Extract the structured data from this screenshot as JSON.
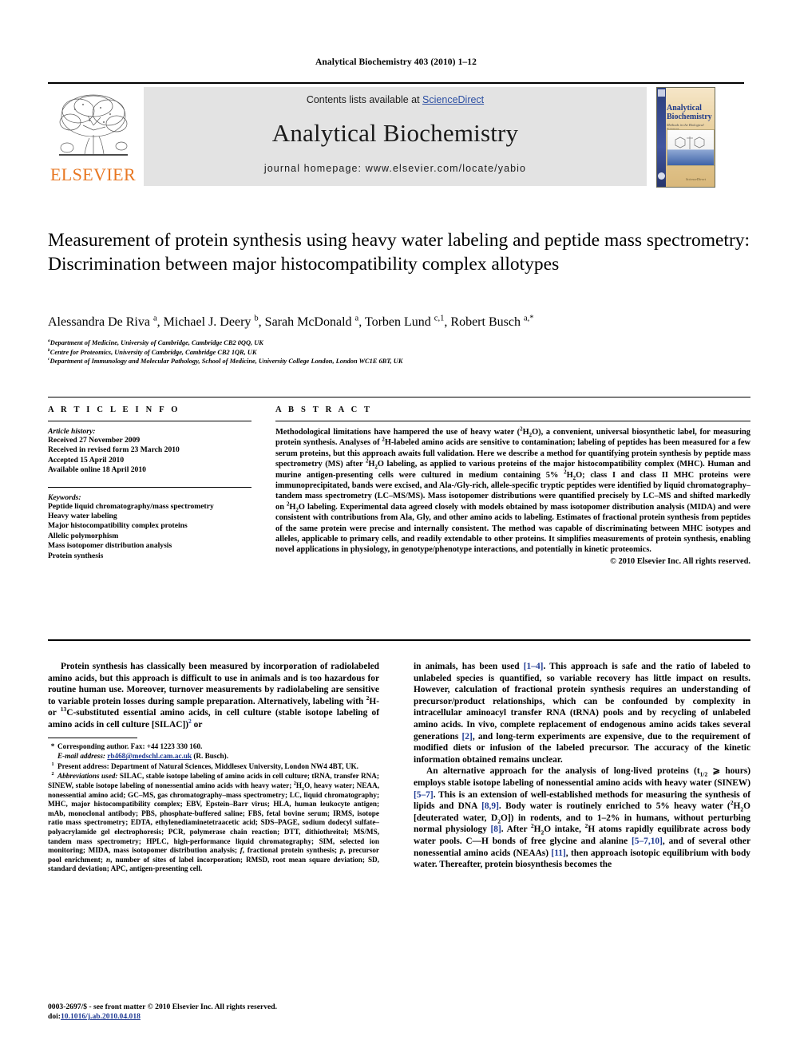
{
  "running_head": "Analytical Biochemistry 403 (2010) 1–12",
  "masthead": {
    "contents_prefix": "Contents lists available at ",
    "sciencedirect": "ScienceDirect",
    "journal_name": "Analytical Biochemistry",
    "homepage": "journal homepage: www.elsevier.com/locate/yabio",
    "publisher": "ELSEVIER",
    "cover": {
      "title_line1": "Analytical",
      "title_line2": "Biochemistry",
      "subtitle": "Methods in the Biological Sciences",
      "footer": "ScienceDirect"
    },
    "colors": {
      "band_bg": "#e3e3e3",
      "elsevier_orange": "#E87722",
      "link_blue": "#2b4ea2"
    }
  },
  "article": {
    "title": "Measurement of protein synthesis using heavy water labeling and peptide mass spectrometry: Discrimination between major histocompatibility complex allotypes",
    "authors_html": "Alessandra De Riva <sup>a</sup>, Michael J. Deery <sup>b</sup>, Sarah McDonald <sup>a</sup>, Torben Lund <sup>c,1</sup>, Robert Busch <sup>a,*</sup>",
    "affiliations": [
      "a Department of Medicine, University of Cambridge, Cambridge CB2 0QQ, UK",
      "b Centre for Proteomics, University of Cambridge, Cambridge CB2 1QR, UK",
      "c Department of Immunology and Molecular Pathology, School of Medicine, University College London, London WC1E 6BT, UK"
    ]
  },
  "article_info": {
    "heading": "A R T I C L E   I N F O",
    "history_label": "Article history:",
    "history": [
      "Received 27 November 2009",
      "Received in revised form 23 March 2010",
      "Accepted 15 April 2010",
      "Available online 18 April 2010"
    ],
    "keywords_label": "Keywords:",
    "keywords": [
      "Peptide liquid chromatography/mass spectrometry",
      "Heavy water labeling",
      "Major histocompatibility complex proteins",
      "Allelic polymorphism",
      "Mass isotopomer distribution analysis",
      "Protein synthesis"
    ]
  },
  "abstract": {
    "heading": "A B S T R A C T",
    "body_html": "Methodological limitations have hampered the use of heavy water (<sup>2</sup>H<sub>2</sub>O), a convenient, universal biosynthetic label, for measuring protein synthesis. Analyses of <sup>2</sup>H-labeled amino acids are sensitive to contamination; labeling of peptides has been measured for a few serum proteins, but this approach awaits full validation. Here we describe a method for quantifying protein synthesis by peptide mass spectrometry (MS) after <sup>2</sup>H<sub>2</sub>O labeling, as applied to various proteins of the major histocompatibility complex (MHC). Human and murine antigen-presenting cells were cultured in medium containing 5% <sup>2</sup>H<sub>2</sub>O; class I and class II MHC proteins were immunoprecipitated, bands were excised, and Ala-/Gly-rich, allele-specific tryptic peptides were identified by liquid chromatography–tandem mass spectrometry (LC–MS/MS). Mass isotopomer distributions were quantified precisely by LC–MS and shifted markedly on <sup>2</sup>H<sub>2</sub>O labeling. Experimental data agreed closely with models obtained by mass isotopomer distribution analysis (MIDA) and were consistent with contributions from Ala, Gly, and other amino acids to labeling. Estimates of fractional protein synthesis from peptides of the same protein were precise and internally consistent. The method was capable of discriminating between MHC isotypes and alleles, applicable to primary cells, and readily extendable to other proteins. It simplifies measurements of protein synthesis, enabling novel applications in physiology, in genotype/phenotype interactions, and potentially in kinetic proteomics.",
    "copyright": "© 2010 Elsevier Inc. All rights reserved."
  },
  "body": {
    "left_paragraph_html": "Protein synthesis has classically been measured by incorporation of radiolabeled amino acids, but this approach is difficult to use in animals and is too hazardous for routine human use. Moreover, turnover measurements by radiolabeling are sensitive to variable protein losses during sample preparation. Alternatively, labeling with <sup>2</sup>H- or <sup>13</sup>C-substituted essential amino acids, in cell culture (stable isotope labeling of amino acids in cell culture [SILAC])<sup class=\"ref\">2</sup> or",
    "right_paragraph_1_html": "in animals, has been used <span class=\"ref\">[1–4]</span>. This approach is safe and the ratio of labeled to unlabeled species is quantified, so variable recovery has little impact on results. However, calculation of fractional protein synthesis requires an understanding of precursor/product relationships, which can be confounded by complexity in intracellular aminoacyl transfer RNA (tRNA) pools and by recycling of unlabeled amino acids. In vivo, complete replacement of endogenous amino acids takes several generations <span class=\"ref\">[2]</span>, and long-term experiments are expensive, due to the requirement of modified diets or infusion of the labeled precursor. The accuracy of the kinetic information obtained remains unclear.",
    "right_paragraph_2_html": "An alternative approach for the analysis of long-lived proteins (t<sub>1/2</sub> ⩾ hours) employs stable isotope labeling of nonessential amino acids with heavy water (SINEW) <span class=\"ref\">[5–7]</span>. This is an extension of well-established methods for measuring the synthesis of lipids and DNA <span class=\"ref\">[8,9]</span>. Body water is routinely enriched to 5% heavy water (<sup>2</sup>H<sub>2</sub>O [deuterated water, D<sub>2</sub>O]) in rodents, and to 1–2% in humans, without perturbing normal physiology <span class=\"ref\">[8]</span>. After <sup>2</sup>H<sub>2</sub>O intake, <sup>2</sup>H atoms rapidly equilibrate across body water pools. C—H bonds of free glycine and alanine <span class=\"ref\">[5–7,10]</span>, and of several other nonessential amino acids (NEAAs) <span class=\"ref\">[11]</span>, then approach isotopic equilibrium with body water. Thereafter, protein biosynthesis becomes the"
  },
  "footnotes": {
    "corresponding_html": "Corresponding author. Fax: +44 1223 330 160.",
    "email_label": "E-mail address:",
    "email_value": "rb468@medschl.cam.ac.uk",
    "email_owner": "(R. Busch).",
    "present_address_html": "Present address: Department of Natural Sciences, Middlesex University, London NW4 4BT, UK.",
    "abbrev_label": "Abbreviations used:",
    "abbrev_html": "SILAC, stable isotope labeling of amino acids in cell culture; tRNA, transfer RNA; SINEW, stable isotope labeling of nonessential amino acids with heavy water; <sup>2</sup>H<sub>2</sub>O, heavy water; NEAA, nonessential amino acid; GC–MS, gas chromatography–mass spectrometry; LC, liquid chromatography; MHC, major histocompatibility complex; EBV, Epstein–Barr virus; HLA, human leukocyte antigen; mAb, monoclonal antibody; PBS, phosphate-buffered saline; FBS, fetal bovine serum; IRMS, isotope ratio mass spectrometry; EDTA, ethylenediaminetetraacetic acid; SDS–PAGE, sodium dodecyl sulfate–polyacrylamide gel electrophoresis; PCR, polymerase chain reaction; DTT, dithiothreitol; MS/MS, tandem mass spectrometry; HPLC, high-performance liquid chromatography; SIM, selected ion monitoring; MIDA, mass isotopomer distribution analysis; <i>f</i>, fractional protein synthesis; <i>p</i>, precursor pool enrichment; <i>n</i>, number of sites of label incorporation; RMSD, root mean square deviation; SD, standard deviation; APC, antigen-presenting cell."
  },
  "page_footer": {
    "issn_line": "0003-2697/$ - see front matter © 2010 Elsevier Inc. All rights reserved.",
    "doi_label": "doi:",
    "doi_value": "10.1016/j.ab.2010.04.018"
  }
}
